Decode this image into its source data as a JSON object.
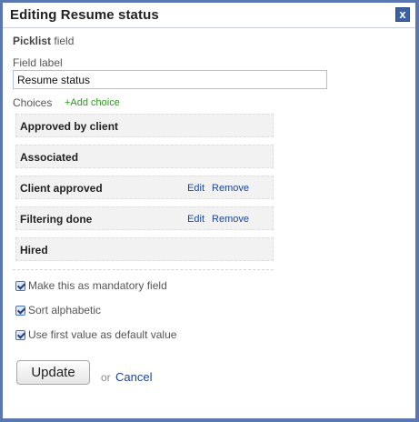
{
  "dialog": {
    "title": "Editing Resume status",
    "close_glyph": "x",
    "close_icon": "close-icon"
  },
  "field": {
    "type_bold": "Picklist",
    "type_suffix": " field",
    "label_caption": "Field label",
    "label_value": "Resume status"
  },
  "choices": {
    "caption": "Choices",
    "add_label": "+Add choice",
    "items": [
      {
        "label": "Approved by client",
        "edit": "",
        "remove": ""
      },
      {
        "label": "Associated",
        "edit": "",
        "remove": ""
      },
      {
        "label": "Client approved",
        "edit": "Edit",
        "remove": "Remove"
      },
      {
        "label": "Filtering done",
        "edit": "Edit",
        "remove": "Remove"
      },
      {
        "label": "Hired",
        "edit": "",
        "remove": ""
      }
    ]
  },
  "options": [
    {
      "label": "Make this as mandatory field",
      "checked": true
    },
    {
      "label": "Sort alphabetic",
      "checked": true
    },
    {
      "label": "Use first value as default value",
      "checked": true
    }
  ],
  "footer": {
    "update_label": "Update",
    "or_label": "or",
    "cancel_label": "Cancel"
  },
  "colors": {
    "frame": "#5a77b2",
    "link": "#1a45a0",
    "add_choice": "#2a9a1a"
  }
}
